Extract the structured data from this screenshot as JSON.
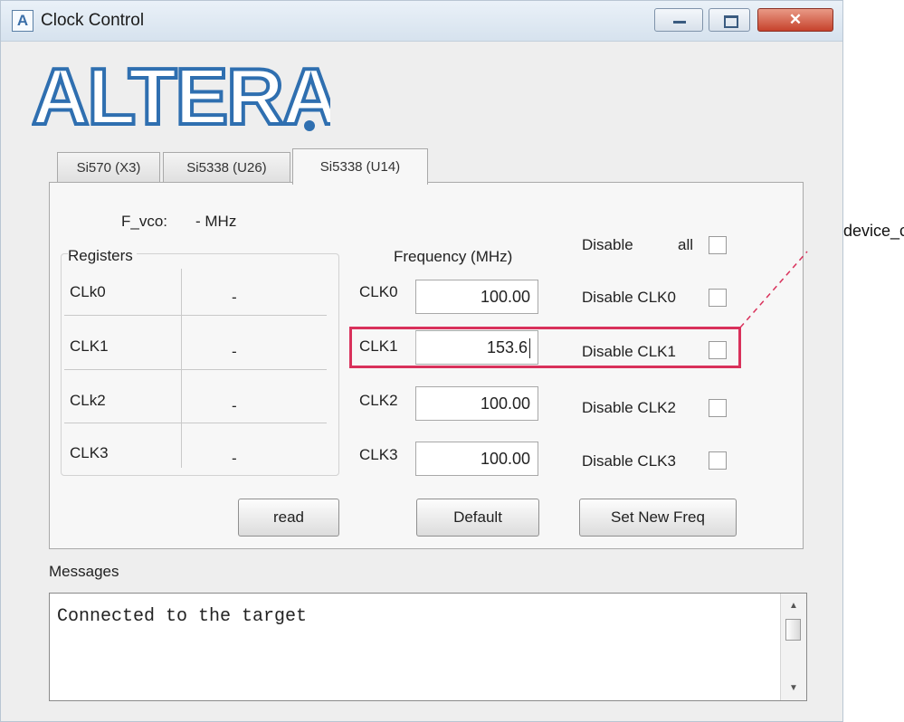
{
  "window": {
    "title": "Clock Control",
    "app_icon": "A"
  },
  "logo": {
    "text": "ALTERA"
  },
  "tabs": [
    {
      "label": "Si570 (X3)"
    },
    {
      "label": "Si5338 (U26)"
    },
    {
      "label": "Si5338 (U14)",
      "active": true
    }
  ],
  "panel": {
    "fvco_label": "F_vco:",
    "fvco_value": "- MHz",
    "registers_label": "Registers",
    "frequency_label": "Frequency (MHz)",
    "disable_label": "Disable",
    "all_label": "all",
    "registers": [
      {
        "name": "CLk0",
        "value": "-"
      },
      {
        "name": "CLK1",
        "value": "-"
      },
      {
        "name": "CLk2",
        "value": "-"
      },
      {
        "name": "CLK3",
        "value": "-"
      }
    ],
    "clocks": [
      {
        "label": "CLK0",
        "freq": "100.00",
        "disable_label": "Disable CLK0"
      },
      {
        "label": "CLK1",
        "freq": "153.6",
        "disable_label": "Disable CLK1"
      },
      {
        "label": "CLK2",
        "freq": "100.00",
        "disable_label": "Disable CLK2"
      },
      {
        "label": "CLK3",
        "freq": "100.00",
        "disable_label": "Disable CLK3"
      }
    ],
    "buttons": {
      "read": "read",
      "default": "Default",
      "set": "Set New Freq"
    }
  },
  "messages": {
    "label": "Messages",
    "text": "Connected to the target"
  },
  "annotation": {
    "label": "device_clk"
  },
  "colors": {
    "highlight": "#d9315b",
    "logo": "#2f6fb0"
  }
}
